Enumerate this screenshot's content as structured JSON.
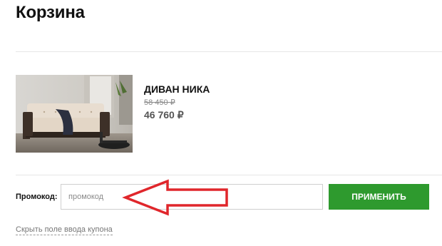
{
  "page": {
    "title": "Корзина"
  },
  "cart": {
    "items": [
      {
        "name": "ДИВАН НИКА",
        "old_price": "58 450 ₽",
        "price": "46 760 ₽",
        "image_icon": "sofa-photo"
      }
    ]
  },
  "coupon": {
    "label": "Промокод:",
    "placeholder": "промокод",
    "value": "",
    "apply_label": "ПРИМЕНИТЬ",
    "hide_link": "Скрыть поле ввода купона"
  },
  "colors": {
    "apply_button": "#2e9a2e",
    "annotation_arrow": "#e0262b",
    "old_price": "#8a8a8a",
    "new_price": "#555555"
  }
}
